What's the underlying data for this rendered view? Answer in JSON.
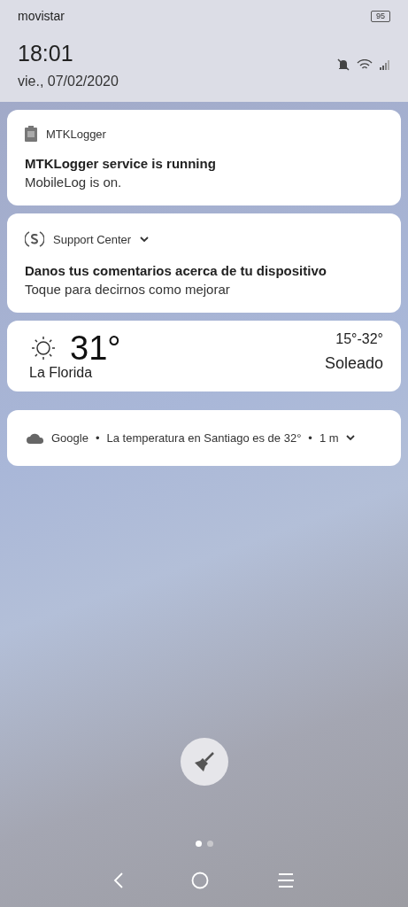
{
  "status_bar": {
    "carrier": "movistar",
    "battery": "95"
  },
  "header": {
    "time": "18:01",
    "date": "vie., 07/02/2020"
  },
  "notifications": [
    {
      "kind": "app",
      "app": "MTKLogger",
      "expandable": false,
      "title": "MTKLogger service is running",
      "text": "MobileLog is on."
    },
    {
      "kind": "app",
      "app": "Support Center",
      "expandable": true,
      "title": "Danos tus comentarios acerca de tu dispositivo",
      "text": "Toque para decirnos como mejorar"
    },
    {
      "kind": "weather",
      "temperature": "31°",
      "place": "La Florida",
      "range": "15°-32°",
      "condition": "Soleado"
    },
    {
      "kind": "compact",
      "app": "Google",
      "separator": "•",
      "text": "La temperatura en Santiago es de 32°",
      "time": "1 m",
      "expandable": true
    }
  ],
  "pages": [
    {
      "selected": true
    },
    {
      "selected": false
    }
  ]
}
